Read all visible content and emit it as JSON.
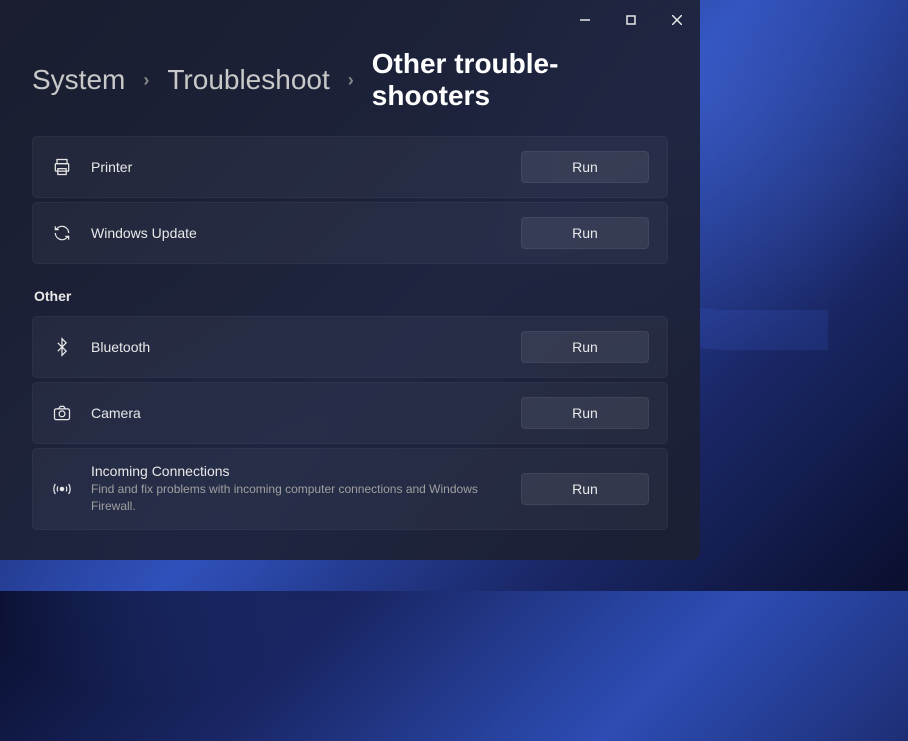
{
  "window": {
    "controls": {
      "minimize": "minimize",
      "maximize": "maximize",
      "close": "close"
    }
  },
  "breadcrumb": {
    "items": [
      "System",
      "Troubleshoot"
    ],
    "current": "Other trouble-shooters"
  },
  "run_label": "Run",
  "groups": [
    {
      "label": null,
      "items": [
        {
          "icon": "printer",
          "title": "Printer",
          "desc": null
        },
        {
          "icon": "sync",
          "title": "Windows Update",
          "desc": null
        }
      ]
    },
    {
      "label": "Other",
      "items": [
        {
          "icon": "bluetooth",
          "title": "Bluetooth",
          "desc": null
        },
        {
          "icon": "camera",
          "title": "Camera",
          "desc": null
        },
        {
          "icon": "broadcast",
          "title": "Incoming Connections",
          "desc": "Find and fix problems with incoming computer connections and Windows Firewall."
        }
      ]
    }
  ]
}
